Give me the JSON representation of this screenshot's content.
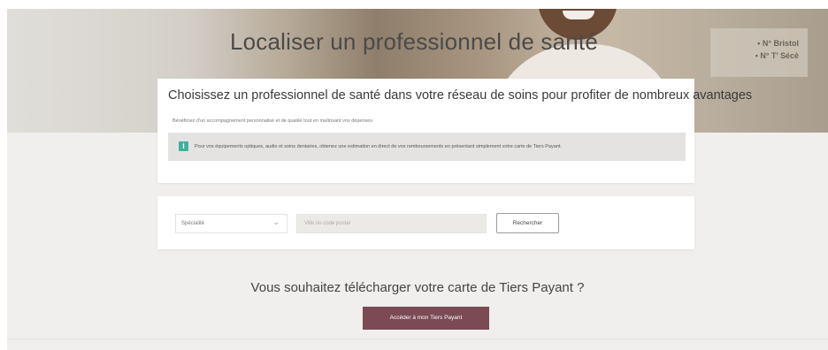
{
  "hero": {
    "title": "Localiser un professionnel de santé",
    "sign_lines": [
      "• N° Bristol",
      "• N° T’ Sécè"
    ]
  },
  "intro_card": {
    "heading": "Choisissez un professionnel de santé dans votre réseau de soins pour profiter de nombreux avantages",
    "subtext": "Bénéficiez d'un accompagnement personnalisé et de qualité tout en maîtrisant vos dépenses",
    "info_icon": "info-icon",
    "info_text": "Pour vos équipements optiques, audio et soins dentaires, obtenez une estimation en direct de vos remboursements en présentant simplement votre carte de Tiers Payant."
  },
  "search": {
    "specialty_label": "Spécialité",
    "city_placeholder": "Ville ou code postal",
    "search_button": "Rechercher"
  },
  "tiers_payant": {
    "title": "Vous souhaitez télécharger votre carte de Tiers Payant ?",
    "button": "Accéder à mon Tiers Payant"
  },
  "colors": {
    "accent": "#7b4a55",
    "info_icon": "#3db19a"
  }
}
